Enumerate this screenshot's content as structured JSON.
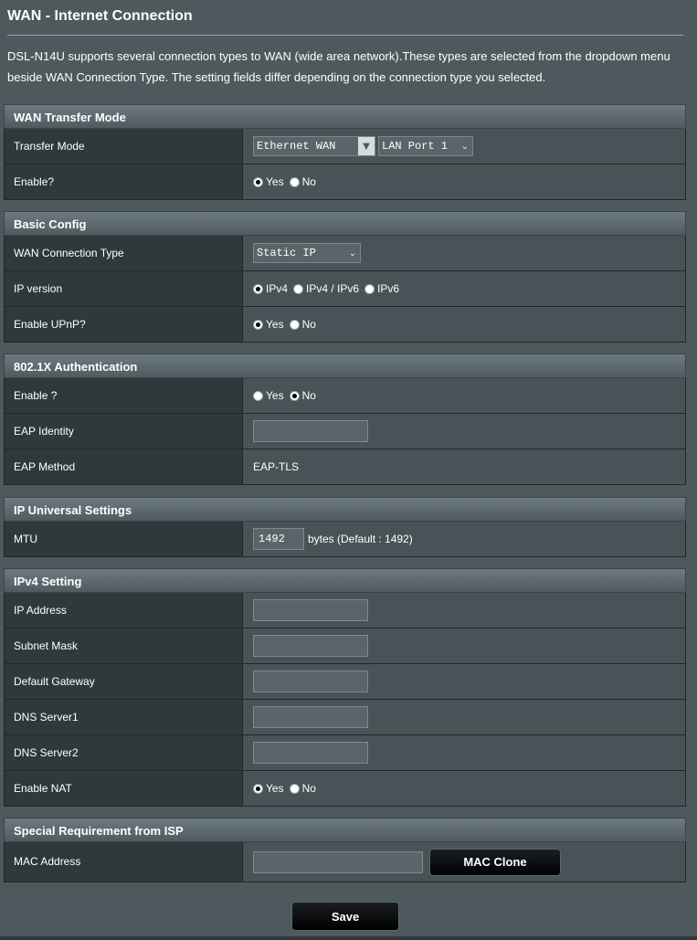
{
  "page": {
    "title": "WAN - Internet Connection",
    "description": "DSL-N14U supports several connection types to WAN (wide area network).These types are selected from the dropdown menu beside WAN Connection Type. The setting fields differ depending on the connection type you selected."
  },
  "transfer": {
    "header": "WAN Transfer Mode",
    "mode_label": "Transfer Mode",
    "mode_value": "Ethernet WAN",
    "port_value": "LAN Port 1",
    "enable_label": "Enable?",
    "yes": "Yes",
    "no": "No"
  },
  "basic": {
    "header": "Basic Config",
    "conn_label": "WAN Connection Type",
    "conn_value": "Static IP",
    "ipver_label": "IP version",
    "ipv4": "IPv4",
    "ipv4v6": "IPv4 / IPv6",
    "ipv6": "IPv6",
    "upnp_label": "Enable UPnP?",
    "yes": "Yes",
    "no": "No"
  },
  "auth": {
    "header": "802.1X Authentication",
    "enable_label": "Enable ?",
    "yes": "Yes",
    "no": "No",
    "identity_label": "EAP Identity",
    "identity_value": "",
    "method_label": "EAP Method",
    "method_value": "EAP-TLS"
  },
  "universal": {
    "header": "IP Universal Settings",
    "mtu_label": "MTU",
    "mtu_value": "1492",
    "mtu_hint": "bytes (Default : 1492)"
  },
  "ipv4": {
    "header": "IPv4 Setting",
    "ip_label": "IP Address",
    "mask_label": "Subnet Mask",
    "gateway_label": "Default Gateway",
    "dns1_label": "DNS Server1",
    "dns2_label": "DNS Server2",
    "nat_label": "Enable NAT",
    "yes": "Yes",
    "no": "No"
  },
  "isp": {
    "header": "Special Requirement from ISP",
    "mac_label": "MAC Address",
    "mac_value": "",
    "mac_clone": "MAC Clone"
  },
  "actions": {
    "save": "Save"
  },
  "icons": {
    "dropdown": "chevron-down-icon",
    "radio": "radio-icon"
  }
}
